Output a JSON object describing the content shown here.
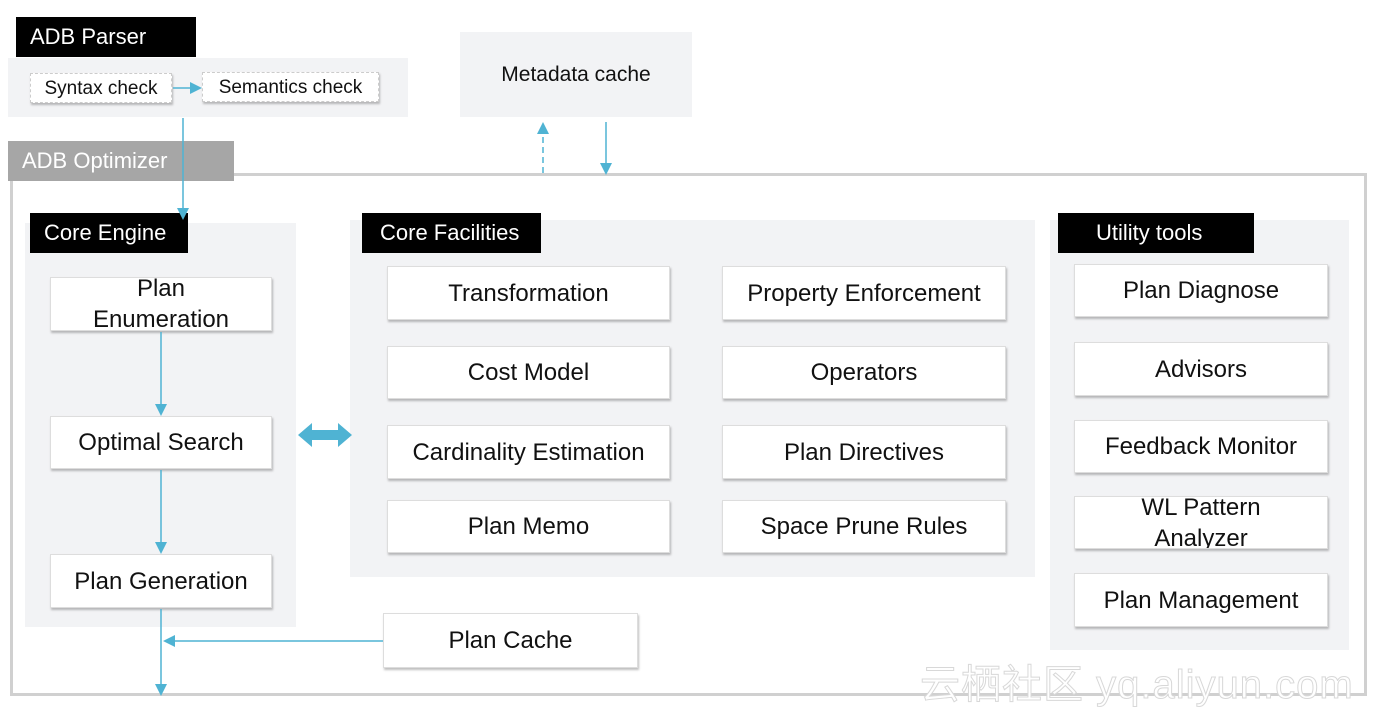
{
  "parser": {
    "title": "ADB Parser",
    "syntax": "Syntax check",
    "semantics": "Semantics check"
  },
  "metadata": "Metadata cache",
  "optimizer": {
    "title": "ADB Optimizer"
  },
  "core_engine": {
    "title": "Core Engine",
    "items": [
      "Plan Enumeration",
      "Optimal Search",
      "Plan Generation"
    ]
  },
  "core_facilities": {
    "title": "Core Facilities",
    "items": [
      "Transformation",
      "Property Enforcement",
      "Cost Model",
      "Operators",
      "Cardinality Estimation",
      "Plan Directives",
      "Plan Memo",
      "Space Prune Rules"
    ]
  },
  "utility": {
    "title": "Utility tools",
    "items": [
      "Plan Diagnose",
      "Advisors",
      "Feedback Monitor",
      "WL Pattern Analyzer",
      "Plan Management"
    ]
  },
  "plan_cache": "Plan Cache",
  "watermark": "云栖社区 yq.aliyun.com",
  "colors": {
    "arrow": "#4fb3d3",
    "panel": "#f2f3f5",
    "label": "#000000",
    "optimizer_label": "#a6a6a6"
  }
}
